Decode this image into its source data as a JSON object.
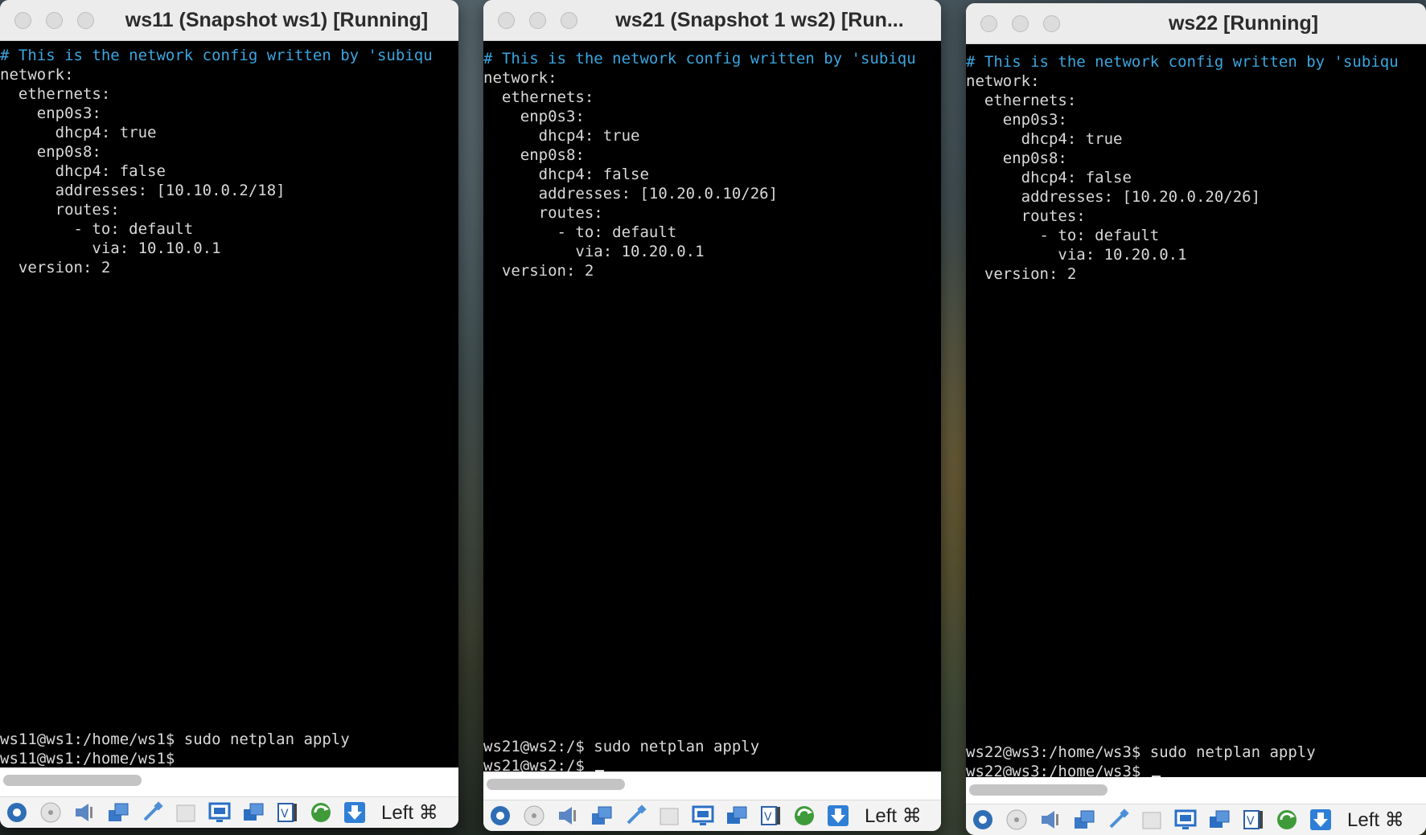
{
  "windows": [
    {
      "title": "ws11 (Snapshot ws1) [Running]",
      "lines": [
        {
          "text": "# This is the network config written by 'subiqu",
          "cls": "comment"
        },
        {
          "text": "network:",
          "cls": ""
        },
        {
          "text": "  ethernets:",
          "cls": ""
        },
        {
          "text": "    enp0s3:",
          "cls": ""
        },
        {
          "text": "      dhcp4: true",
          "cls": ""
        },
        {
          "text": "    enp0s8:",
          "cls": ""
        },
        {
          "text": "      dhcp4: false",
          "cls": ""
        },
        {
          "text": "      addresses: [10.10.0.2/18]",
          "cls": ""
        },
        {
          "text": "      routes:",
          "cls": ""
        },
        {
          "text": "        - to: default",
          "cls": ""
        },
        {
          "text": "          via: 10.10.0.1",
          "cls": ""
        },
        {
          "text": "  version: 2",
          "cls": ""
        }
      ],
      "prompt_lines": [
        "ws11@ws1:/home/ws1$ sudo netplan apply",
        "ws11@ws1:/home/ws1$"
      ],
      "cursor": false,
      "host_key": "Left ⌘"
    },
    {
      "title": "ws21 (Snapshot 1 ws2) [Run...",
      "lines": [
        {
          "text": "# This is the network config written by 'subiqu",
          "cls": "comment"
        },
        {
          "text": "network:",
          "cls": ""
        },
        {
          "text": "  ethernets:",
          "cls": ""
        },
        {
          "text": "    enp0s3:",
          "cls": ""
        },
        {
          "text": "      dhcp4: true",
          "cls": ""
        },
        {
          "text": "    enp0s8:",
          "cls": ""
        },
        {
          "text": "      dhcp4: false",
          "cls": ""
        },
        {
          "text": "      addresses: [10.20.0.10/26]",
          "cls": ""
        },
        {
          "text": "      routes:",
          "cls": ""
        },
        {
          "text": "        - to: default",
          "cls": ""
        },
        {
          "text": "          via: 10.20.0.1",
          "cls": ""
        },
        {
          "text": "  version: 2",
          "cls": ""
        }
      ],
      "prompt_lines": [
        "ws21@ws2:/$ sudo netplan apply",
        "ws21@ws2:/$"
      ],
      "cursor": true,
      "host_key": "Left ⌘"
    },
    {
      "title": "ws22 [Running]",
      "lines": [
        {
          "text": "# This is the network config written by 'subiqu",
          "cls": "comment"
        },
        {
          "text": "network:",
          "cls": ""
        },
        {
          "text": "  ethernets:",
          "cls": ""
        },
        {
          "text": "    enp0s3:",
          "cls": ""
        },
        {
          "text": "      dhcp4: true",
          "cls": ""
        },
        {
          "text": "    enp0s8:",
          "cls": ""
        },
        {
          "text": "      dhcp4: false",
          "cls": ""
        },
        {
          "text": "      addresses: [10.20.0.20/26]",
          "cls": ""
        },
        {
          "text": "      routes:",
          "cls": ""
        },
        {
          "text": "        - to: default",
          "cls": ""
        },
        {
          "text": "          via: 10.20.0.1",
          "cls": ""
        },
        {
          "text": "  version: 2",
          "cls": ""
        }
      ],
      "prompt_lines": [
        "ws22@ws3:/home/ws3$ sudo netplan apply",
        "ws22@ws3:/home/ws3$"
      ],
      "cursor": true,
      "host_key": "Left ⌘"
    }
  ],
  "status_icons": [
    "hard-disk-icon",
    "optical-drive-icon",
    "audio-icon",
    "network-icon",
    "usb-icon",
    "shared-folders-icon",
    "display-icon",
    "screen-capture-icon",
    "video-recording-icon",
    "cpu-activity-icon",
    "keyboard-capture-icon"
  ]
}
